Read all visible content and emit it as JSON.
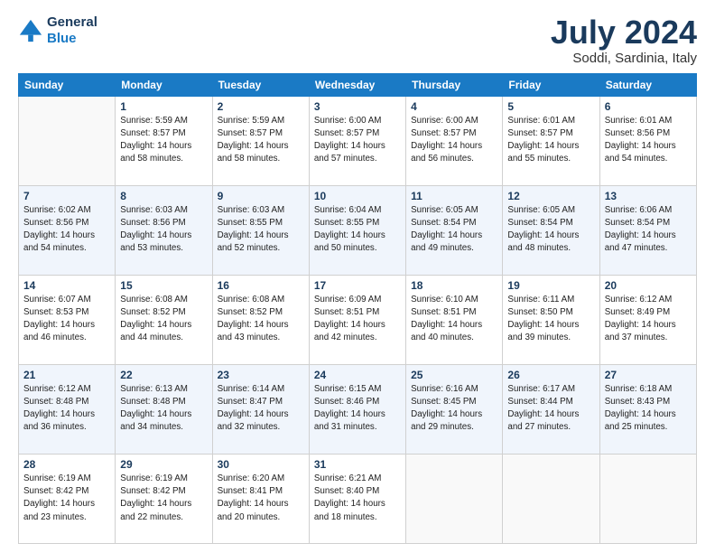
{
  "header": {
    "logo_line1": "General",
    "logo_line2": "Blue",
    "title": "July 2024",
    "subtitle": "Soddi, Sardinia, Italy"
  },
  "calendar": {
    "days_of_week": [
      "Sunday",
      "Monday",
      "Tuesday",
      "Wednesday",
      "Thursday",
      "Friday",
      "Saturday"
    ],
    "weeks": [
      [
        {
          "day": "",
          "info": ""
        },
        {
          "day": "1",
          "info": "Sunrise: 5:59 AM\nSunset: 8:57 PM\nDaylight: 14 hours\nand 58 minutes."
        },
        {
          "day": "2",
          "info": "Sunrise: 5:59 AM\nSunset: 8:57 PM\nDaylight: 14 hours\nand 58 minutes."
        },
        {
          "day": "3",
          "info": "Sunrise: 6:00 AM\nSunset: 8:57 PM\nDaylight: 14 hours\nand 57 minutes."
        },
        {
          "day": "4",
          "info": "Sunrise: 6:00 AM\nSunset: 8:57 PM\nDaylight: 14 hours\nand 56 minutes."
        },
        {
          "day": "5",
          "info": "Sunrise: 6:01 AM\nSunset: 8:57 PM\nDaylight: 14 hours\nand 55 minutes."
        },
        {
          "day": "6",
          "info": "Sunrise: 6:01 AM\nSunset: 8:56 PM\nDaylight: 14 hours\nand 54 minutes."
        }
      ],
      [
        {
          "day": "7",
          "info": "Sunrise: 6:02 AM\nSunset: 8:56 PM\nDaylight: 14 hours\nand 54 minutes."
        },
        {
          "day": "8",
          "info": "Sunrise: 6:03 AM\nSunset: 8:56 PM\nDaylight: 14 hours\nand 53 minutes."
        },
        {
          "day": "9",
          "info": "Sunrise: 6:03 AM\nSunset: 8:55 PM\nDaylight: 14 hours\nand 52 minutes."
        },
        {
          "day": "10",
          "info": "Sunrise: 6:04 AM\nSunset: 8:55 PM\nDaylight: 14 hours\nand 50 minutes."
        },
        {
          "day": "11",
          "info": "Sunrise: 6:05 AM\nSunset: 8:54 PM\nDaylight: 14 hours\nand 49 minutes."
        },
        {
          "day": "12",
          "info": "Sunrise: 6:05 AM\nSunset: 8:54 PM\nDaylight: 14 hours\nand 48 minutes."
        },
        {
          "day": "13",
          "info": "Sunrise: 6:06 AM\nSunset: 8:54 PM\nDaylight: 14 hours\nand 47 minutes."
        }
      ],
      [
        {
          "day": "14",
          "info": "Sunrise: 6:07 AM\nSunset: 8:53 PM\nDaylight: 14 hours\nand 46 minutes."
        },
        {
          "day": "15",
          "info": "Sunrise: 6:08 AM\nSunset: 8:52 PM\nDaylight: 14 hours\nand 44 minutes."
        },
        {
          "day": "16",
          "info": "Sunrise: 6:08 AM\nSunset: 8:52 PM\nDaylight: 14 hours\nand 43 minutes."
        },
        {
          "day": "17",
          "info": "Sunrise: 6:09 AM\nSunset: 8:51 PM\nDaylight: 14 hours\nand 42 minutes."
        },
        {
          "day": "18",
          "info": "Sunrise: 6:10 AM\nSunset: 8:51 PM\nDaylight: 14 hours\nand 40 minutes."
        },
        {
          "day": "19",
          "info": "Sunrise: 6:11 AM\nSunset: 8:50 PM\nDaylight: 14 hours\nand 39 minutes."
        },
        {
          "day": "20",
          "info": "Sunrise: 6:12 AM\nSunset: 8:49 PM\nDaylight: 14 hours\nand 37 minutes."
        }
      ],
      [
        {
          "day": "21",
          "info": "Sunrise: 6:12 AM\nSunset: 8:48 PM\nDaylight: 14 hours\nand 36 minutes."
        },
        {
          "day": "22",
          "info": "Sunrise: 6:13 AM\nSunset: 8:48 PM\nDaylight: 14 hours\nand 34 minutes."
        },
        {
          "day": "23",
          "info": "Sunrise: 6:14 AM\nSunset: 8:47 PM\nDaylight: 14 hours\nand 32 minutes."
        },
        {
          "day": "24",
          "info": "Sunrise: 6:15 AM\nSunset: 8:46 PM\nDaylight: 14 hours\nand 31 minutes."
        },
        {
          "day": "25",
          "info": "Sunrise: 6:16 AM\nSunset: 8:45 PM\nDaylight: 14 hours\nand 29 minutes."
        },
        {
          "day": "26",
          "info": "Sunrise: 6:17 AM\nSunset: 8:44 PM\nDaylight: 14 hours\nand 27 minutes."
        },
        {
          "day": "27",
          "info": "Sunrise: 6:18 AM\nSunset: 8:43 PM\nDaylight: 14 hours\nand 25 minutes."
        }
      ],
      [
        {
          "day": "28",
          "info": "Sunrise: 6:19 AM\nSunset: 8:42 PM\nDaylight: 14 hours\nand 23 minutes."
        },
        {
          "day": "29",
          "info": "Sunrise: 6:19 AM\nSunset: 8:42 PM\nDaylight: 14 hours\nand 22 minutes."
        },
        {
          "day": "30",
          "info": "Sunrise: 6:20 AM\nSunset: 8:41 PM\nDaylight: 14 hours\nand 20 minutes."
        },
        {
          "day": "31",
          "info": "Sunrise: 6:21 AM\nSunset: 8:40 PM\nDaylight: 14 hours\nand 18 minutes."
        },
        {
          "day": "",
          "info": ""
        },
        {
          "day": "",
          "info": ""
        },
        {
          "day": "",
          "info": ""
        }
      ]
    ]
  }
}
